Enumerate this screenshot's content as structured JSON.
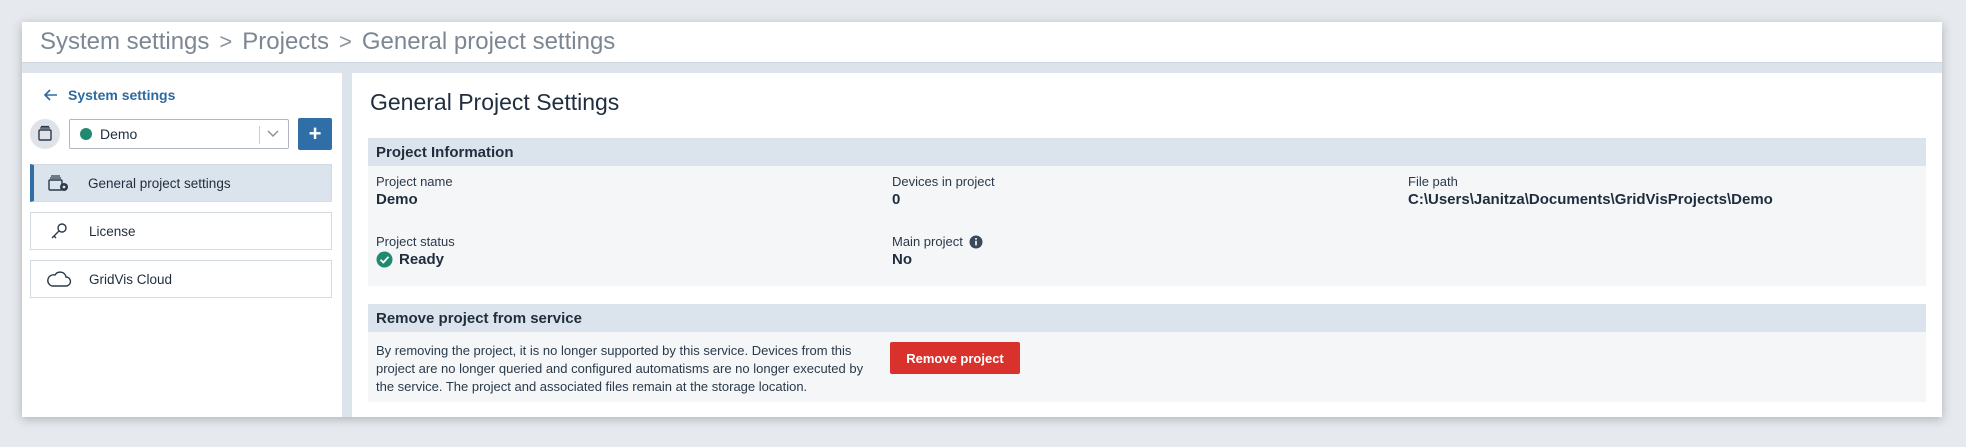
{
  "breadcrumb": [
    "System settings",
    "Projects",
    "General project settings"
  ],
  "breadcrumb_separator": ">",
  "sidebar": {
    "back_label": "System settings",
    "project_select": {
      "value": "Demo",
      "status_color": "#1f8a70"
    },
    "add_button_label": "+",
    "items": [
      {
        "label": "General project settings",
        "icon": "project-settings-icon",
        "active": true
      },
      {
        "label": "License",
        "icon": "key-icon",
        "active": false
      },
      {
        "label": "GridVis Cloud",
        "icon": "cloud-icon",
        "active": false
      }
    ]
  },
  "main": {
    "title": "General Project Settings",
    "project_info": {
      "header": "Project Information",
      "project_name_label": "Project name",
      "project_name": "Demo",
      "devices_label": "Devices in project",
      "devices": "0",
      "file_path_label": "File path",
      "file_path": "C:\\Users\\Janitza\\Documents\\GridVisProjects\\Demo",
      "status_label": "Project status",
      "status": "Ready",
      "main_project_label": "Main project",
      "main_project": "No"
    },
    "remove": {
      "header": "Remove project from service",
      "description_lines": [
        "By removing the project, it is no longer supported by this service. Devices from this",
        "project are no longer queried and configured automatisms are no longer executed by",
        "the service. The project and associated files remain at the storage location."
      ],
      "button_label": "Remove project"
    }
  },
  "colors": {
    "accent": "#2f6ea6",
    "danger": "#d9312b",
    "success": "#1f8a70",
    "link": "#2e6a9e"
  }
}
